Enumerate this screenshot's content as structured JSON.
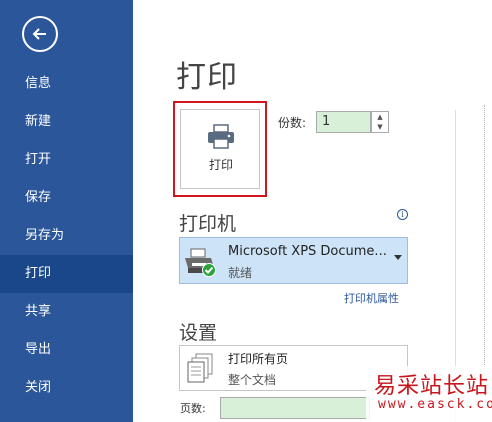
{
  "sidebar": {
    "items": [
      {
        "label": "信息"
      },
      {
        "label": "新建"
      },
      {
        "label": "打开"
      },
      {
        "label": "保存"
      },
      {
        "label": "另存为"
      },
      {
        "label": "打印"
      },
      {
        "label": "共享"
      },
      {
        "label": "导出"
      },
      {
        "label": "关闭"
      }
    ],
    "active": "打印",
    "back_icon": "back-arrow-icon"
  },
  "main": {
    "title": "打印",
    "print_button_label": "打印",
    "copies": {
      "label": "份数:",
      "value": "1"
    }
  },
  "printer": {
    "section_title": "打印机",
    "name": "Microsoft XPS Docume...",
    "status": "就绪",
    "properties_link": "打印机属性",
    "info_icon": "ⓘ"
  },
  "settings": {
    "section_title": "设置",
    "selection_main": "打印所有页",
    "selection_sub": "整个文档",
    "pages_label": "页数:",
    "pages_value": ""
  },
  "watermark": {
    "text": "易采站长站",
    "url": "www.easck.com"
  },
  "colors": {
    "sidebar_bg": "#2b579a",
    "sidebar_active": "#19478a",
    "highlight_border": "#d0161c",
    "input_green": "#d7f0d7",
    "printer_select_bg": "#cde3f8"
  }
}
